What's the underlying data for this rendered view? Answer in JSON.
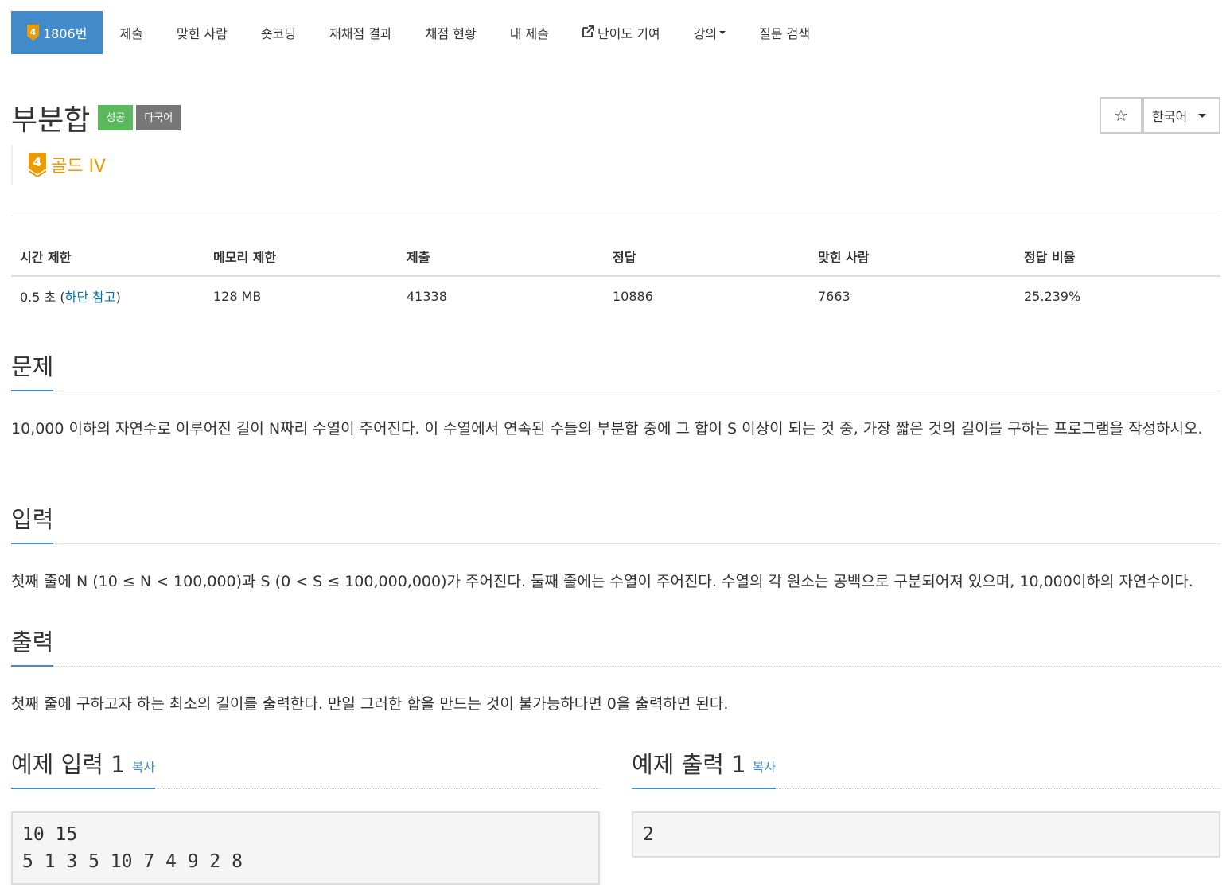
{
  "nav": {
    "problem_tab": "1806번",
    "tier_badge_number": "4",
    "tabs": [
      "제출",
      "맞힌 사람",
      "숏코딩",
      "재채점 결과",
      "채점 현황",
      "내 제출",
      "난이도 기여",
      "강의",
      "질문 검색"
    ]
  },
  "problem": {
    "title": "부분합",
    "label_success": "성공",
    "label_multilang": "다국어",
    "tier_number": "4",
    "tier_text": "골드 IV",
    "tier_color": "#ec9a00"
  },
  "buttons": {
    "star": "☆",
    "language": "한국어"
  },
  "info_table": {
    "headers": [
      "시간 제한",
      "메모리 제한",
      "제출",
      "정답",
      "맞힌 사람",
      "정답 비율"
    ],
    "time_limit_prefix": "0.5 초 (",
    "time_limit_link": "하단 참고",
    "time_limit_suffix": ")",
    "memory_limit": "128 MB",
    "submissions": "41338",
    "accepted": "10886",
    "solved": "7663",
    "ratio": "25.239%"
  },
  "sections": {
    "problem_title": "문제",
    "problem_text": "10,000 이하의 자연수로 이루어진 길이 N짜리 수열이 주어진다. 이 수열에서 연속된 수들의 부분합 중에 그 합이 S 이상이 되는 것 중, 가장 짧은 것의 길이를 구하는 프로그램을 작성하시오.",
    "input_title": "입력",
    "input_text": "첫째 줄에 N (10 ≤ N < 100,000)과 S (0 < S ≤ 100,000,000)가 주어진다. 둘째 줄에는 수열이 주어진다. 수열의 각 원소는 공백으로 구분되어져 있으며, 10,000이하의 자연수이다.",
    "output_title": "출력",
    "output_text": "첫째 줄에 구하고자 하는 최소의 길이를 출력한다. 만일 그러한 합을 만드는 것이 불가능하다면 0을 출력하면 된다."
  },
  "samples": {
    "input_title": "예제 입력 1",
    "output_title": "예제 출력 1",
    "copy_label": "복사",
    "input_text": "10 15\n5 1 3 5 10 7 4 9 2 8",
    "output_text": "2"
  },
  "colors": {
    "primary": "#428bca",
    "success": "#5cb85c",
    "label_gray": "#777777",
    "link": "#0076c0"
  }
}
